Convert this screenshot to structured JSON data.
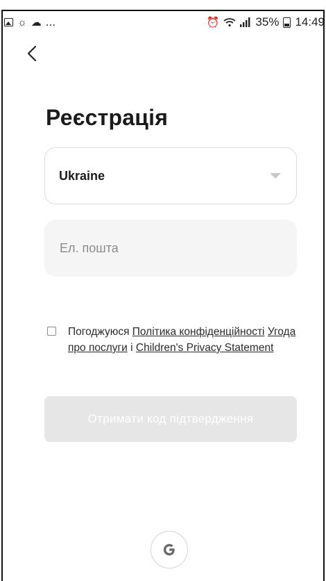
{
  "statusbar": {
    "left_icons": [
      "image-icon",
      "brightness-icon",
      "cloud-icon"
    ],
    "ellipsis": "...",
    "right_icons": [
      "alarm-icon",
      "wifi-icon",
      "signal-icon"
    ],
    "battery": "35%",
    "time": "14:49"
  },
  "page": {
    "title": "Реєстрація"
  },
  "form": {
    "country": "Ukraine",
    "email_placeholder": "Ел. пошта",
    "email_value": ""
  },
  "consent": {
    "prefix": "Погоджуюся ",
    "privacy_link": "Політика конфіденційності",
    "terms_link": "Угода про послуги",
    "conjunction": " і ",
    "children_link": "Children's Privacy Statement"
  },
  "actions": {
    "get_code_label": "Отримати код підтвердження",
    "google_letter": "G"
  },
  "colors": {
    "button_disabled": "#e6e6e6",
    "input_bg": "#f5f5f5"
  }
}
